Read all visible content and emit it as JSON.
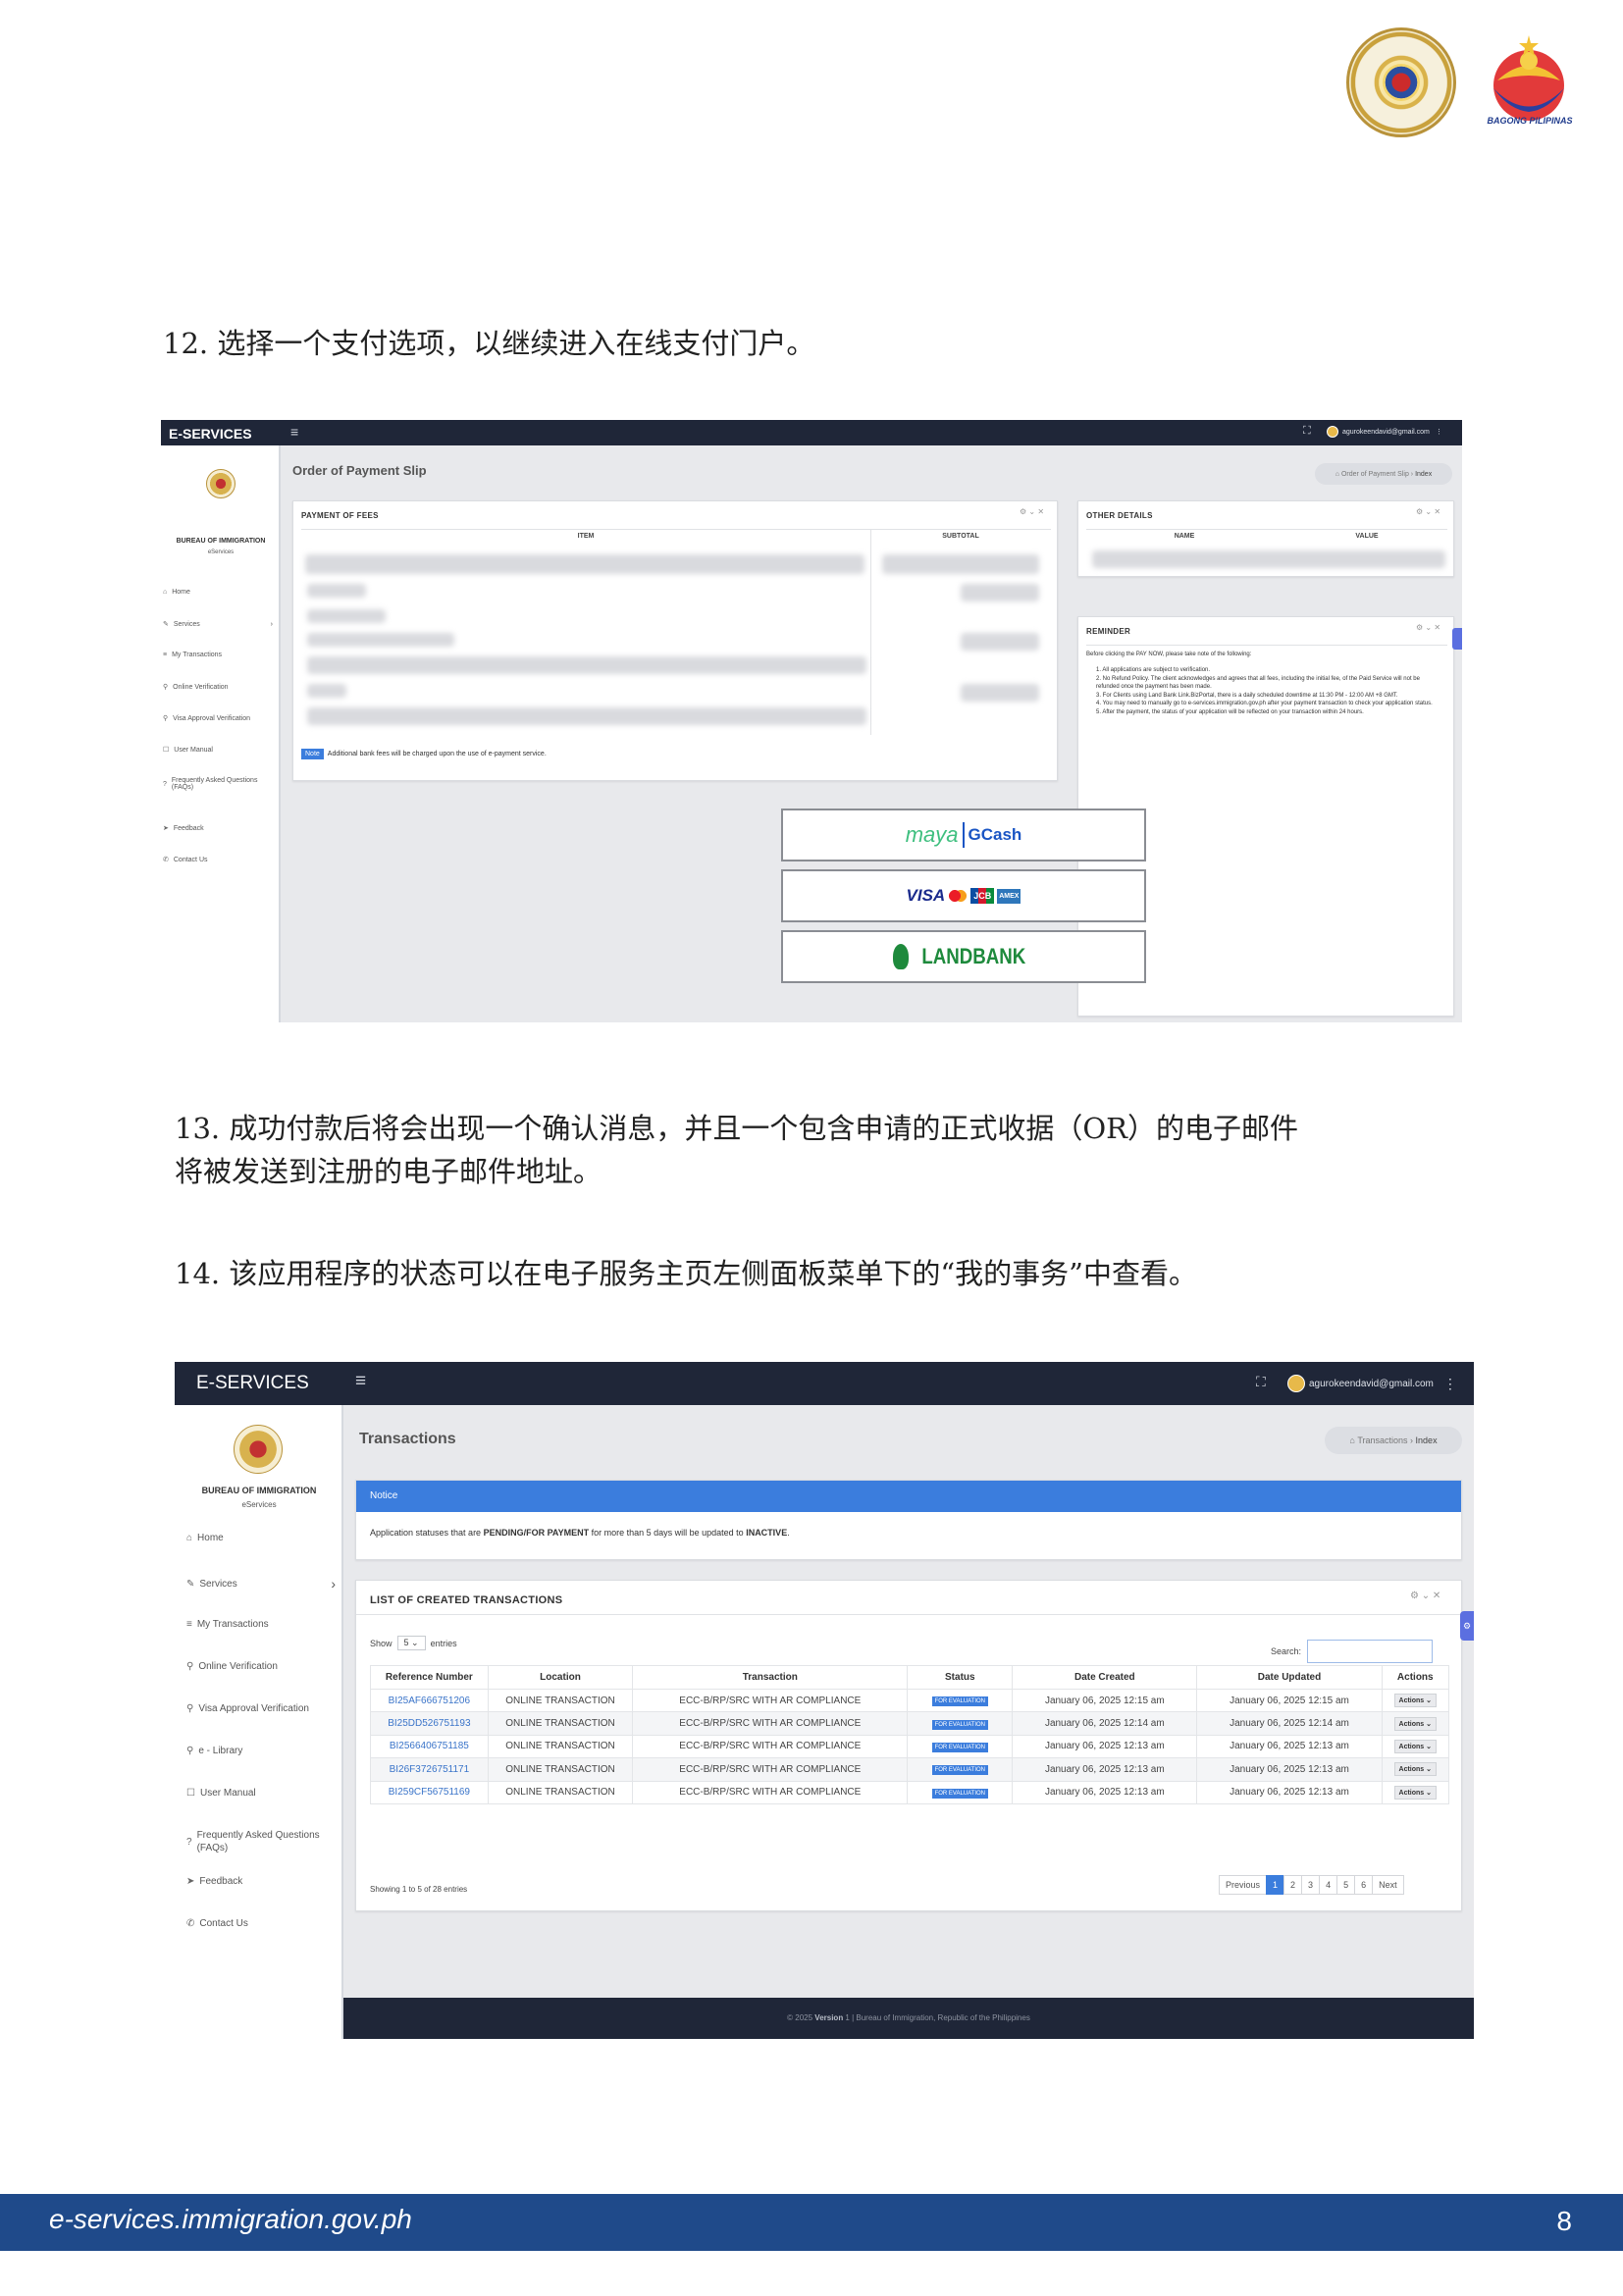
{
  "header": {
    "logo_text": "BAGONG PILIPINAS",
    "seal_text": "BUREAU OF IMMIGRATION · DEPARTMENT OF JUSTICE"
  },
  "steps": {
    "s12": "12. 选择一个支付选项，以继续进入在线支付门户。",
    "s13_line1": "13. 成功付款后将会出现一个确认消息，并且一个包含申请的正式收据（OR）的电子邮件",
    "s13_line2": "将被发送到注册的电子邮件地址。",
    "s14": "14. 该应用程序的状态可以在电子服务主页左侧面板菜单下的“我的事务”中查看。"
  },
  "shot1": {
    "brand": "E-SERVICES",
    "user_email": "agurokeendavid@gmail.com",
    "org": "BUREAU OF IMMIGRATION",
    "org_sub": "eServices",
    "menu": [
      "Home",
      "Services",
      "My Transactions",
      "Online Verification",
      "Visa Approval Verification",
      "User Manual",
      "Frequently Asked Questions (FAQs)",
      "Feedback",
      "Contact Us"
    ],
    "page_title": "Order of Payment Slip",
    "breadcrumb_page": "Order of Payment Slip",
    "breadcrumb_current": "Index",
    "fees_title": "PAYMENT OF FEES",
    "fees_col_item": "ITEM",
    "fees_col_subtotal": "SUBTOTAL",
    "note_badge": "Note",
    "note_text": "Additional bank fees will be charged upon the use of e-payment service.",
    "other_title": "OTHER DETAILS",
    "other_col_name": "NAME",
    "other_col_value": "VALUE",
    "reminder_title": "REMINDER",
    "reminder_intro": "Before clicking the PAY NOW, please take note of the following:",
    "reminder_items": [
      "1. All applications are subject to verification.",
      "2. No Refund Policy. The client acknowledges and agrees that all fees, including the initial fee, of the Paid Service will not be refunded once the payment has been made.",
      "3. For Clients using Land Bank Link.BizPortal, there is a daily scheduled downtime at 11:30 PM - 12:00 AM +8 GMT.",
      "4. You may need to manually go to e-services.immigration.gov.ph after your payment transaction to check your application status.",
      "5. After the payment, the status of your application will be reflected on your transaction within 24 hours."
    ],
    "pay_maya": "maya",
    "pay_gcash": "GCash",
    "pay_visa": "VISA",
    "pay_jcb": "JCB",
    "pay_amex": "AMEX",
    "pay_landbank": "LANDBANK"
  },
  "shot2": {
    "brand": "E-SERVICES",
    "user_email": "agurokeendavid@gmail.com",
    "org": "BUREAU OF IMMIGRATION",
    "org_sub": "eServices",
    "menu": [
      "Home",
      "Services",
      "My Transactions",
      "Online Verification",
      "Visa Approval Verification",
      "e - Library",
      "User Manual",
      "Frequently Asked Questions (FAQs)",
      "Feedback",
      "Contact Us"
    ],
    "page_title": "Transactions",
    "breadcrumb_page": "Transactions",
    "breadcrumb_current": "Index",
    "notice_title": "Notice",
    "notice_pre": "Application statuses that are ",
    "notice_bold1": "PENDING/FOR PAYMENT",
    "notice_mid": " for more than 5 days will be updated to ",
    "notice_bold2": "INACTIVE",
    "notice_end": ".",
    "list_title": "LIST OF CREATED TRANSACTIONS",
    "show_label": "Show",
    "show_value": "5",
    "entries_label": "entries",
    "search_label": "Search:",
    "columns": [
      "Reference Number",
      "Location",
      "Transaction",
      "Status",
      "Date Created",
      "Date Updated",
      "Actions"
    ],
    "rows": [
      [
        "BI25AF666751206",
        "ONLINE TRANSACTION",
        "ECC-B/RP/SRC WITH AR COMPLIANCE",
        "FOR EVALUATION",
        "January 06, 2025 12:15 am",
        "January 06, 2025 12:15 am",
        "Actions"
      ],
      [
        "BI25DD526751193",
        "ONLINE TRANSACTION",
        "ECC-B/RP/SRC WITH AR COMPLIANCE",
        "FOR EVALUATION",
        "January 06, 2025 12:14 am",
        "January 06, 2025 12:14 am",
        "Actions"
      ],
      [
        "BI2566406751185",
        "ONLINE TRANSACTION",
        "ECC-B/RP/SRC WITH AR COMPLIANCE",
        "FOR EVALUATION",
        "January 06, 2025 12:13 am",
        "January 06, 2025 12:13 am",
        "Actions"
      ],
      [
        "BI26F3726751171",
        "ONLINE TRANSACTION",
        "ECC-B/RP/SRC WITH AR COMPLIANCE",
        "FOR EVALUATION",
        "January 06, 2025 12:13 am",
        "January 06, 2025 12:13 am",
        "Actions"
      ],
      [
        "BI259CF56751169",
        "ONLINE TRANSACTION",
        "ECC-B/RP/SRC WITH AR COMPLIANCE",
        "FOR EVALUATION",
        "January 06, 2025 12:13 am",
        "January 06, 2025 12:13 am",
        "Actions"
      ]
    ],
    "showing": "Showing 1 to 5 of 28 entries",
    "pagination": [
      "Previous",
      "1",
      "2",
      "3",
      "4",
      "5",
      "6",
      "Next"
    ],
    "footer_pre": "© 2025 ",
    "footer_version": "Version",
    "footer_post": " 1 | Bureau of Immigration, Republic of the Philippines"
  },
  "footer": {
    "url": "e-services.immigration.gov.ph",
    "page": "8"
  },
  "colors": {
    "topbar": "#1f2638",
    "accent": "#3b7ddd",
    "footer": "#1f4a8a"
  }
}
